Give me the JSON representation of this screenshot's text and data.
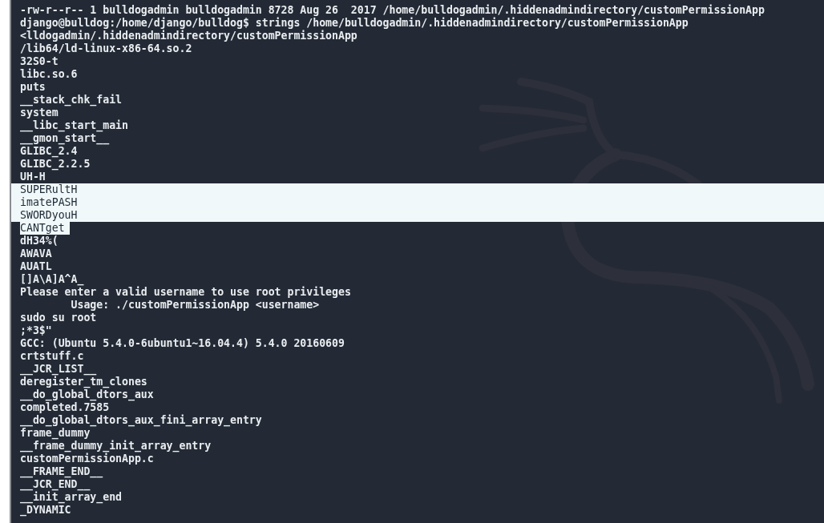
{
  "terminal": {
    "lines": [
      {
        "text": "-rw-r--r-- 1 bulldogadmin bulldogadmin 8728 Aug 26  2017 /home/bulldogadmin/.hiddenadmindirectory/customPermissionApp",
        "selected": false
      },
      {
        "text": "django@bulldog:/home/django/bulldog$ strings /home/bulldogadmin/.hiddenadmindirectory/customPermissionApp",
        "selected": false
      },
      {
        "text": "<lldogadmin/.hiddenadmindirectory/customPermissionApp",
        "selected": false
      },
      {
        "text": "/lib64/ld-linux-x86-64.so.2",
        "selected": false
      },
      {
        "text": "32S0-t",
        "selected": false
      },
      {
        "text": "libc.so.6",
        "selected": false
      },
      {
        "text": "puts",
        "selected": false
      },
      {
        "text": "__stack_chk_fail",
        "selected": false
      },
      {
        "text": "system",
        "selected": false
      },
      {
        "text": "__libc_start_main",
        "selected": false
      },
      {
        "text": "__gmon_start__",
        "selected": false
      },
      {
        "text": "GLIBC_2.4",
        "selected": false
      },
      {
        "text": "GLIBC_2.2.5",
        "selected": false
      },
      {
        "text": "UH-H",
        "selected": false
      },
      {
        "text": "SUPERultH",
        "selected": true
      },
      {
        "text": "imatePASH",
        "selected": true
      },
      {
        "text": "SWORDyouH",
        "selected": true
      },
      {
        "text": "CANTget",
        "selected": true
      },
      {
        "text": "dH34%(",
        "selected": false
      },
      {
        "text": "AWAVA",
        "selected": false
      },
      {
        "text": "AUATL",
        "selected": false
      },
      {
        "text": "[]A\\A]A^A_",
        "selected": false
      },
      {
        "text": "Please enter a valid username to use root privileges",
        "selected": false
      },
      {
        "text": "\tUsage: ./customPermissionApp <username>",
        "selected": false
      },
      {
        "text": "sudo su root",
        "selected": false
      },
      {
        "text": ";*3$\"",
        "selected": false
      },
      {
        "text": "GCC: (Ubuntu 5.4.0-6ubuntu1~16.04.4) 5.4.0 20160609",
        "selected": false
      },
      {
        "text": "crtstuff.c",
        "selected": false
      },
      {
        "text": "__JCR_LIST__",
        "selected": false
      },
      {
        "text": "deregister_tm_clones",
        "selected": false
      },
      {
        "text": "__do_global_dtors_aux",
        "selected": false
      },
      {
        "text": "completed.7585",
        "selected": false
      },
      {
        "text": "__do_global_dtors_aux_fini_array_entry",
        "selected": false
      },
      {
        "text": "frame_dummy",
        "selected": false
      },
      {
        "text": "__frame_dummy_init_array_entry",
        "selected": false
      },
      {
        "text": "customPermissionApp.c",
        "selected": false
      },
      {
        "text": "__FRAME_END__",
        "selected": false
      },
      {
        "text": "__JCR_END__",
        "selected": false
      },
      {
        "text": "__init_array_end",
        "selected": false
      },
      {
        "text": "_DYNAMIC",
        "selected": false
      }
    ]
  }
}
